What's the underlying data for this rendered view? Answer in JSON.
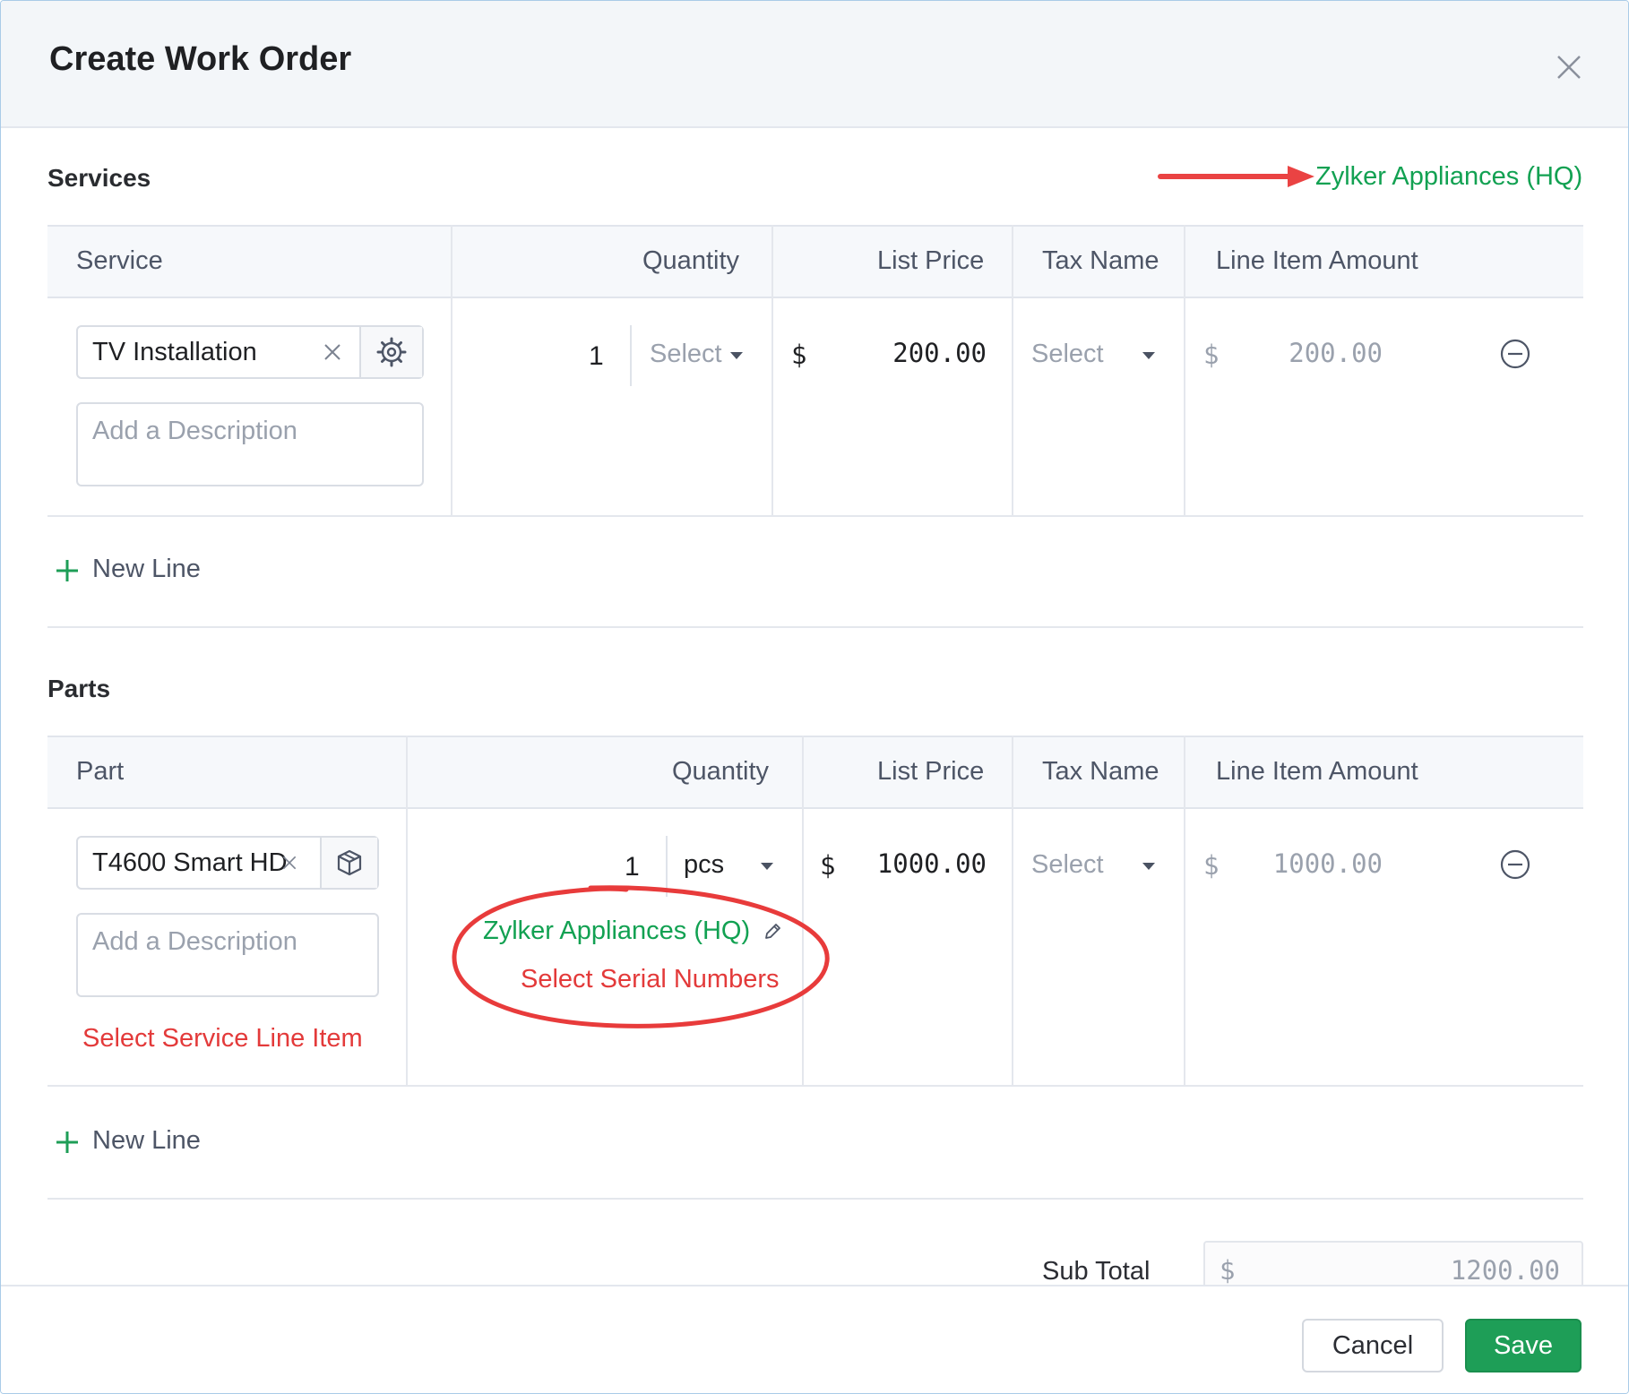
{
  "modal": {
    "title": "Create Work Order"
  },
  "services": {
    "title": "Services",
    "location_link": "Zylker Appliances (HQ)",
    "columns": [
      "Service",
      "Quantity",
      "List Price",
      "Tax Name",
      "Line Item Amount"
    ],
    "row": {
      "item": "TV Installation",
      "description_placeholder": "Add a Description",
      "quantity": "1",
      "unit_placeholder": "Select",
      "currency": "$",
      "list_price": "200.00",
      "tax_placeholder": "Select",
      "amount": "200.00"
    },
    "new_line_label": "New Line"
  },
  "parts": {
    "title": "Parts",
    "columns": [
      "Part",
      "Quantity",
      "List Price",
      "Tax Name",
      "Line Item Amount"
    ],
    "row": {
      "item": "T4600 Smart HD",
      "description_placeholder": "Add a Description",
      "select_service_line": "Select Service Line Item",
      "quantity": "1",
      "unit": "pcs",
      "location": "Zylker Appliances (HQ)",
      "select_serial": "Select Serial Numbers",
      "currency": "$",
      "list_price": "1000.00",
      "tax_placeholder": "Select",
      "amount": "1000.00"
    },
    "new_line_label": "New Line"
  },
  "summary": {
    "sub_total_label": "Sub Total",
    "currency": "$",
    "sub_total": "1200.00"
  },
  "footer": {
    "cancel_label": "Cancel",
    "save_label": "Save"
  },
  "colors": {
    "accent_green": "#1e9e57",
    "link_green": "#12a152",
    "annotation_red": "#e33a3a"
  },
  "icons": [
    "close-icon",
    "clear-icon",
    "service-gear-icon",
    "box-icon",
    "plus-icon",
    "remove-circle-icon",
    "edit-pencil-icon",
    "caret-down-icon"
  ]
}
